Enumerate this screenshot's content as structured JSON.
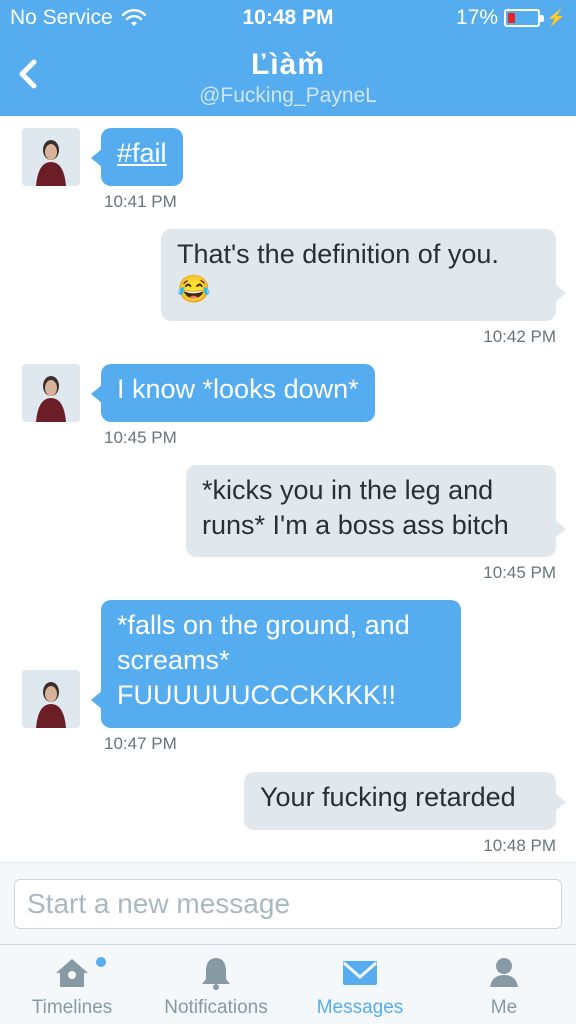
{
  "status_bar": {
    "carrier": "No Service",
    "time": "10:48 PM",
    "battery": "17%"
  },
  "header": {
    "title": "Ľìàm̌",
    "handle": "@Fucking_PayneL"
  },
  "messages": [
    {
      "direction": "in",
      "text": "#fail",
      "time": "10:41 PM"
    },
    {
      "direction": "out",
      "text": "That's the definition of you.",
      "emoji": "😂",
      "time": "10:42 PM"
    },
    {
      "direction": "in",
      "text": "I know *looks down*",
      "time": "10:45 PM"
    },
    {
      "direction": "out",
      "line1": "*kicks you in the leg and",
      "line2": "runs* I'm a boss ass bitch",
      "time": "10:45 PM"
    },
    {
      "direction": "in",
      "line1": "*falls on the ground, and",
      "line2": "screams*",
      "line3": "FUUUUUUCCCKKKK!!",
      "time": "10:47 PM"
    },
    {
      "direction": "out",
      "text": "Your fucking retarded",
      "time": "10:48 PM"
    }
  ],
  "composer": {
    "placeholder": "Start a new message"
  },
  "tabs": [
    {
      "label": "Timelines",
      "icon": "home-icon",
      "active": false
    },
    {
      "label": "Notifications",
      "icon": "bell-icon",
      "active": false
    },
    {
      "label": "Messages",
      "icon": "envelope-icon",
      "active": true
    },
    {
      "label": "Me",
      "icon": "person-icon",
      "active": false
    }
  ],
  "colors": {
    "brand": "#55acee",
    "incoming_bubble": "#55acee",
    "outgoing_bubble": "#e1e8ed",
    "battery_low": "#e2271f"
  }
}
